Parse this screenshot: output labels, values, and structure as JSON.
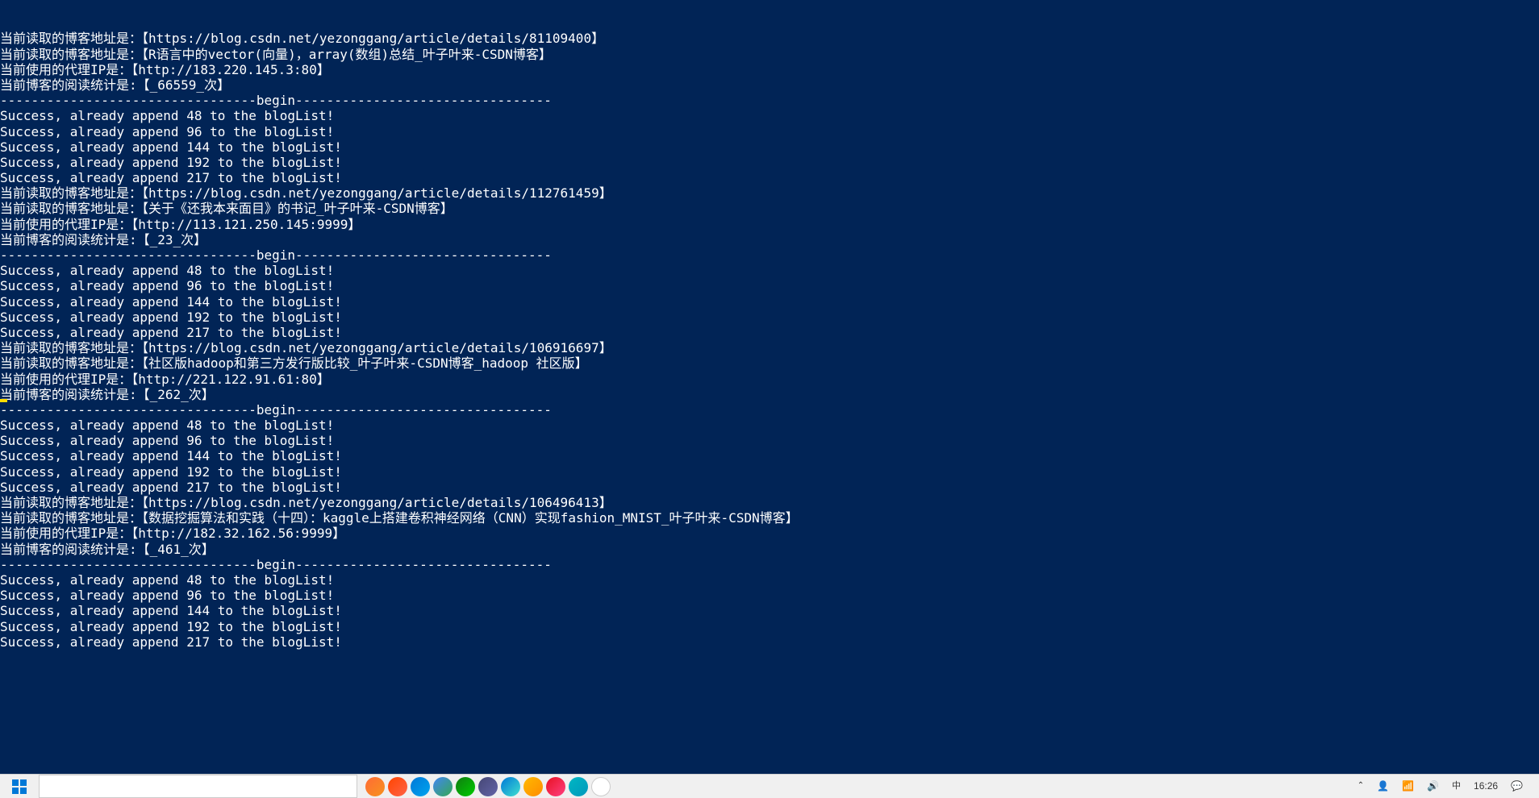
{
  "terminal": {
    "lines": [
      "当前读取的博客地址是：【https://blog.csdn.net/yezonggang/article/details/81109400】",
      "当前读取的博客地址是：【R语言中的vector(向量)，array(数组)总结_叶子叶来-CSDN博客】",
      "当前使用的代理IP是：【http://183.220.145.3:80】",
      "当前博客的阅读统计是:【_66559_次】",
      "---------------------------------begin---------------------------------",
      "Success, already append 48 to the blogList!",
      "Success, already append 96 to the blogList!",
      "Success, already append 144 to the blogList!",
      "Success, already append 192 to the blogList!",
      "Success, already append 217 to the blogList!",
      "当前读取的博客地址是：【https://blog.csdn.net/yezonggang/article/details/112761459】",
      "当前读取的博客地址是：【关于《还我本来面目》的书记_叶子叶来-CSDN博客】",
      "当前使用的代理IP是：【http://113.121.250.145:9999】",
      "当前博客的阅读统计是:【_23_次】",
      "---------------------------------begin---------------------------------",
      "Success, already append 48 to the blogList!",
      "Success, already append 96 to the blogList!",
      "Success, already append 144 to the blogList!",
      "Success, already append 192 to the blogList!",
      "Success, already append 217 to the blogList!",
      "当前读取的博客地址是：【https://blog.csdn.net/yezonggang/article/details/106916697】",
      "当前读取的博客地址是：【社区版hadoop和第三方发行版比较_叶子叶来-CSDN博客_hadoop 社区版】",
      "当前使用的代理IP是：【http://221.122.91.61:80】",
      "当前博客的阅读统计是:【_262_次】",
      "---------------------------------begin---------------------------------",
      "Success, already append 48 to the blogList!",
      "Success, already append 96 to the blogList!",
      "Success, already append 144 to the blogList!",
      "Success, already append 192 to the blogList!",
      "Success, already append 217 to the blogList!",
      "当前读取的博客地址是：【https://blog.csdn.net/yezonggang/article/details/106496413】",
      "当前读取的博客地址是：【数据挖掘算法和实践（十四）：kaggle上搭建卷积神经网络（CNN）实现fashion_MNIST_叶子叶来-CSDN博客】",
      "当前使用的代理IP是：【http://182.32.162.56:9999】",
      "当前博客的阅读统计是:【_461_次】",
      "---------------------------------begin---------------------------------",
      "Success, already append 48 to the blogList!",
      "Success, already append 96 to the blogList!",
      "Success, already append 144 to the blogList!",
      "Success, already append 192 to the blogList!",
      "Success, already append 217 to the blogList!"
    ]
  },
  "taskbar": {
    "clock": "16:26"
  },
  "colors": {
    "terminal_bg": "#012456",
    "terminal_fg": "#ffffff",
    "taskbar_bg": "#f0f0f0"
  }
}
